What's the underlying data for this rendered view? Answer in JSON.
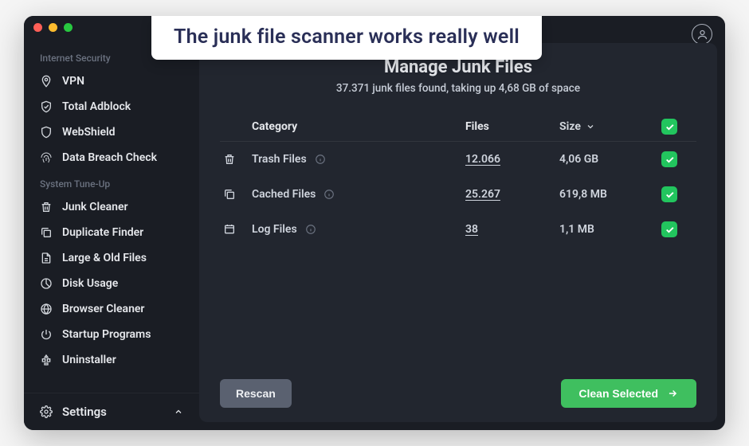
{
  "callout": "The junk file scanner works really well",
  "sidebar": {
    "section1_label": "Internet Security",
    "section2_label": "System Tune-Up",
    "items1": [
      {
        "icon": "vpn",
        "label": "VPN"
      },
      {
        "icon": "adblock",
        "label": "Total Adblock"
      },
      {
        "icon": "shield",
        "label": "WebShield"
      },
      {
        "icon": "fingerprint",
        "label": "Data Breach Check"
      }
    ],
    "items2": [
      {
        "icon": "trash",
        "label": "Junk Cleaner"
      },
      {
        "icon": "duplicate",
        "label": "Duplicate Finder"
      },
      {
        "icon": "file",
        "label": "Large & Old Files"
      },
      {
        "icon": "disk",
        "label": "Disk Usage"
      },
      {
        "icon": "globe",
        "label": "Browser Cleaner"
      },
      {
        "icon": "power",
        "label": "Startup Programs"
      },
      {
        "icon": "apps",
        "label": "Uninstaller"
      }
    ],
    "settings_label": "Settings"
  },
  "main": {
    "title": "Manage Junk Files",
    "subtitle": "37.371 junk files found, taking up 4,68 GB of space",
    "headers": {
      "category": "Category",
      "files": "Files",
      "size": "Size"
    },
    "rows": [
      {
        "icon": "trash",
        "name": "Trash Files",
        "files": "12.066",
        "size": "4,06 GB",
        "checked": true
      },
      {
        "icon": "cache",
        "name": "Cached Files",
        "files": "25.267",
        "size": "619,8 MB",
        "checked": true
      },
      {
        "icon": "log",
        "name": "Log Files",
        "files": "38",
        "size": "1,1 MB",
        "checked": true
      }
    ],
    "rescan_label": "Rescan",
    "clean_label": "Clean Selected"
  }
}
